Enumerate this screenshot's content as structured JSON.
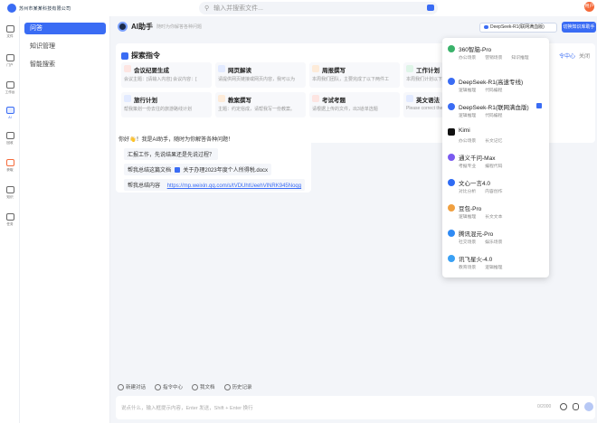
{
  "header": {
    "logo_text": "苏州市某某科技有限公司",
    "search_placeholder": "输入并搜索文件...",
    "avatar_text": "用户"
  },
  "rail": [
    {
      "label": "文件",
      "icon": "folder-icon"
    },
    {
      "label": "门户",
      "icon": "portal-icon"
    },
    {
      "label": "工作台",
      "icon": "workbench-icon"
    },
    {
      "label": "AI",
      "icon": "ai-icon"
    },
    {
      "label": "回收",
      "icon": "recycle-icon"
    },
    {
      "label": "获取",
      "icon": "download-icon"
    },
    {
      "label": "知识",
      "icon": "knowledge-icon"
    },
    {
      "label": "任务",
      "icon": "task-icon"
    }
  ],
  "sidebar": {
    "items": [
      {
        "label": "问答"
      },
      {
        "label": "知识管理"
      },
      {
        "label": "智能搜索"
      }
    ]
  },
  "ai": {
    "title": "AI助手",
    "subtitle": "随时为你解答各种问题",
    "model_selected": "DeepSeek-R1(联网满血版)",
    "kb_button": "切换知识库助手"
  },
  "search_panel": {
    "title": "探索指令",
    "center_link": "令中心",
    "about_link": "关闭"
  },
  "cards": [
    {
      "title": "会议纪要生成",
      "desc": "会议主题：[请输入内容] 会议内容：[",
      "color": "#f05a4a"
    },
    {
      "title": "网页解读",
      "desc": "请提供网页链接或网页内容，我可以为",
      "color": "#3a6cf4"
    },
    {
      "title": "周报撰写",
      "desc": "本周我们团队，主要完成了以下两件工",
      "color": "#f08a3a"
    },
    {
      "title": "工作计划",
      "desc": "本周我们计划以下工作",
      "color": "#2fb36a"
    },
    {
      "title": "旅行计划",
      "desc": "帮我策划一份去往的旅游路线计划",
      "color": "#3a6cf4"
    },
    {
      "title": "教案撰写",
      "desc": "主题：约定俗成，请帮我写一份教案。",
      "color": "#f08a3a"
    },
    {
      "title": "考试考题",
      "desc": "请根据上传的文件，出3道单选题",
      "color": "#f05a4a"
    },
    {
      "title": "英文语法",
      "desc": "Please correct the grammar",
      "color": "#3a6cf4"
    }
  ],
  "chat": {
    "greeting": "你好👋！我是AI助手，随时为你解答各种问题！",
    "suggestions": [
      {
        "text": "汇报工作，先说结果还是先说过程？"
      },
      {
        "prefix": "帮我总结这篇文档",
        "file": "关于办理2023年度个人所得税.docx"
      },
      {
        "prefix": "帮我总结内容",
        "link": "https://mp.weixin.qq.com/s/tVDUhtUeehVlNRK945Noqg"
      }
    ]
  },
  "toolbar": {
    "items": [
      "新建对话",
      "指令中心",
      "我文档",
      "历史记录"
    ]
  },
  "input": {
    "placeholder": "说点什么，输入框提示内容，Enter 发送，Shift + Enter 换行",
    "counter": "0/2000"
  },
  "dropdown": {
    "items": [
      {
        "name": "360智脑-Pro",
        "tags": [
          "办公场景",
          "营销场景",
          "知识推理"
        ],
        "color": "#3ab26a"
      },
      {
        "name": "DeepSeek-R1(高速专线)",
        "tags": [
          "逻辑推理",
          "代码编程"
        ],
        "color": "#3a6cf4"
      },
      {
        "name": "DeepSeek-R1(联网满血版)",
        "tags": [
          "逻辑推理",
          "代码编程"
        ],
        "color": "#3a6cf4",
        "selected": true
      },
      {
        "name": "Kimi",
        "tags": [
          "办公场景",
          "长文记忆"
        ],
        "color": "#111111"
      },
      {
        "name": "通义千问-Max",
        "tags": [
          "考据专业",
          "编程代码"
        ],
        "color": "#7a5af0"
      },
      {
        "name": "文心一言4.0",
        "tags": [
          "对比分析",
          "内容创作"
        ],
        "color": "#2f6bf4"
      },
      {
        "name": "豆包-Pro",
        "tags": [
          "逻辑推理",
          "长文文本"
        ],
        "color": "#f0a040"
      },
      {
        "name": "腾讯混元-Pro",
        "tags": [
          "社交场景",
          "娱乐场景"
        ],
        "color": "#2f8af4"
      },
      {
        "name": "讯飞星火-4.0",
        "tags": [
          "教育场景",
          "逻辑推理"
        ],
        "color": "#3aa0f4"
      }
    ]
  }
}
